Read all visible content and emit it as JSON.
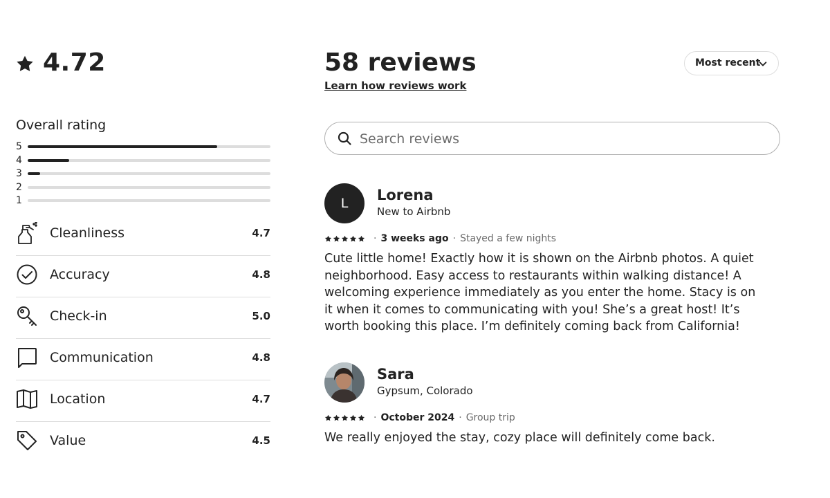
{
  "summary": {
    "overall_score": "4.72",
    "overall_rating_title": "Overall rating",
    "distribution": [
      {
        "stars": "5",
        "fraction": 0.78
      },
      {
        "stars": "4",
        "fraction": 0.17
      },
      {
        "stars": "3",
        "fraction": 0.05
      },
      {
        "stars": "2",
        "fraction": 0.0
      },
      {
        "stars": "1",
        "fraction": 0.0
      }
    ],
    "categories": [
      {
        "label": "Cleanliness",
        "value": "4.7",
        "icon": "spray-bottle-icon"
      },
      {
        "label": "Accuracy",
        "value": "4.8",
        "icon": "check-circle-icon"
      },
      {
        "label": "Check-in",
        "value": "5.0",
        "icon": "key-icon"
      },
      {
        "label": "Communication",
        "value": "4.8",
        "icon": "chat-bubble-icon"
      },
      {
        "label": "Location",
        "value": "4.7",
        "icon": "map-icon"
      },
      {
        "label": "Value",
        "value": "4.5",
        "icon": "price-tag-icon"
      }
    ]
  },
  "header": {
    "reviews_count": "58 reviews",
    "learn_link": "Learn how reviews work",
    "sort_label": "Most recent"
  },
  "search": {
    "placeholder": "Search reviews"
  },
  "reviews": [
    {
      "avatar_letter": "L",
      "name": "Lorena",
      "subtitle": "New to Airbnb",
      "rating": 5,
      "date": "3 weeks ago",
      "stay": "Stayed a few nights",
      "text": "Cute little home! Exactly how it is shown on the Airbnb photos. A quiet neighborhood. Easy access to restaurants within walking distance! A welcoming experience immediately as you enter the home. Stacy is on it when it comes to communicating with you! She’s a great host! It’s worth booking this place. I’m definitely coming back from California!"
    },
    {
      "avatar_letter": "",
      "name": "Sara",
      "subtitle": "Gypsum, Colorado",
      "rating": 5,
      "date": "October 2024",
      "stay": "Group trip",
      "text": "We really enjoyed the stay, cozy place will definitely come back."
    }
  ],
  "colors": {
    "text": "#222222",
    "muted": "#6a6a6a",
    "divider": "#dddddd"
  }
}
